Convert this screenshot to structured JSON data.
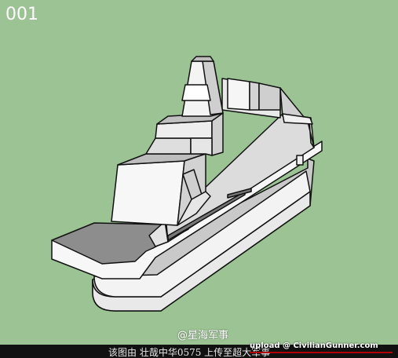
{
  "image": {
    "counter": "001",
    "subject_icon": "warship-3d-model",
    "background_color": "#9cc394",
    "watermark": "@星海军事",
    "footer_credit": "该图由 壮哉中华0575 上传至超大军事",
    "upload_tag": "upload @ CivilianGunner.com"
  }
}
